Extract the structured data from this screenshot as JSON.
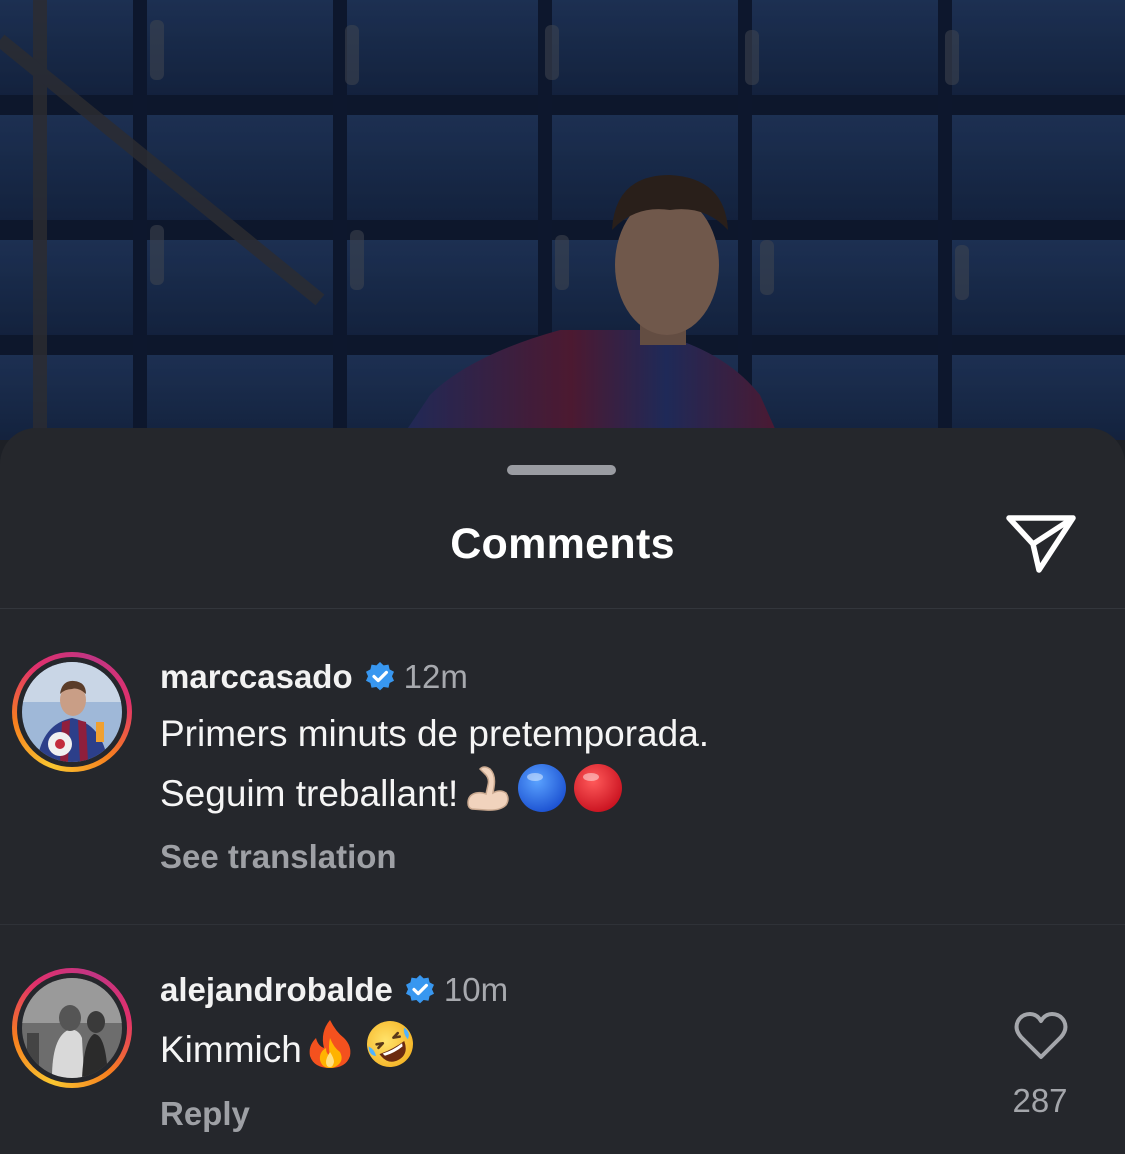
{
  "sheet": {
    "title": "Comments",
    "share_icon": "paper-plane-icon"
  },
  "comments": [
    {
      "username": "marccasado",
      "verified": true,
      "time": "12m",
      "text_line1": "Primers minuts de pretemporada.",
      "text_line2": "Seguim treballant!",
      "emojis": [
        "flexed-biceps",
        "blue-circle",
        "red-circle"
      ],
      "action": "See translation"
    },
    {
      "username": "alejandrobalde",
      "verified": true,
      "time": "10m",
      "text_line1": "Kimmich",
      "emojis": [
        "fire",
        "rolling-on-the-floor-laughing"
      ],
      "action": "Reply",
      "like_count": "287"
    }
  ],
  "colors": {
    "sheet_bg": "#25272c",
    "verified_blue": "#3897f0",
    "muted_text": "#9ea0a5"
  }
}
